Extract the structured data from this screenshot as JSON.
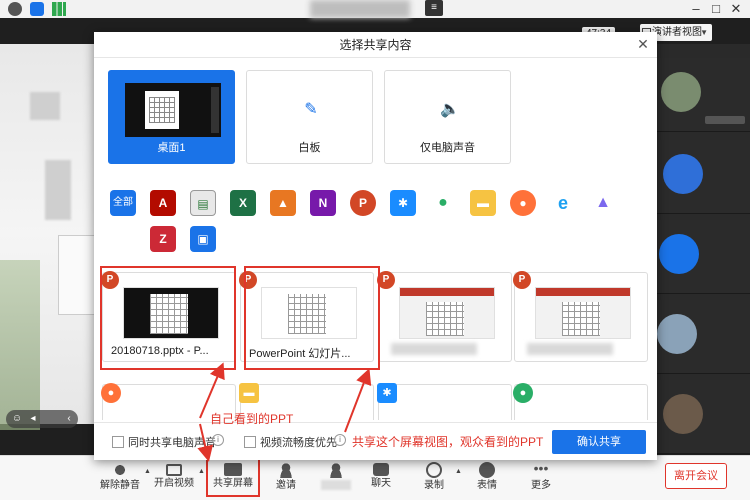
{
  "top_bar": {
    "time": "47:34",
    "view_label": "演讲者视图",
    "window_controls": [
      "minimize-icon",
      "maximize-icon",
      "close-icon"
    ]
  },
  "dialog": {
    "title": "选择共享内容",
    "close_icon": "close-icon",
    "main_options": [
      {
        "label": "桌面1",
        "selected": true
      },
      {
        "label": "白板",
        "icon": "pen-icon"
      },
      {
        "label": "仅电脑声音",
        "icon": "speaker-icon"
      }
    ],
    "filter_all": "全部",
    "app_icons": [
      "acrobat-icon",
      "app-window-icon",
      "excel-icon",
      "matlab-icon",
      "onenote-icon",
      "powerpoint-icon",
      "dingtalk-icon",
      "wechat-icon",
      "folder-icon",
      "firefox-icon",
      "ie-icon",
      "triangle-app-icon",
      "zotero-icon",
      "blue-window-icon"
    ],
    "windows": [
      {
        "label": "20180718.pptx - P..."
      },
      {
        "label": "PowerPoint 幻灯片..."
      },
      {
        "label": ""
      },
      {
        "label": ""
      }
    ],
    "footer": {
      "share_audio": "同时共享电脑声音",
      "video_smooth": "视频流畅度优先",
      "confirm": "确认共享"
    }
  },
  "annotations": {
    "own_view": "自己看到的PPT",
    "audience_view": "共享这个屏幕视图，观众看到的PPT"
  },
  "toolbar": {
    "items": [
      {
        "label": "解除静音",
        "icon": "mic-muted-icon"
      },
      {
        "label": "开启视频",
        "icon": "camera-off-icon"
      },
      {
        "label": "共享屏幕",
        "icon": "share-screen-icon"
      },
      {
        "label": "邀请",
        "icon": "invite-icon"
      },
      {
        "label": "",
        "icon": "participants-icon"
      },
      {
        "label": "聊天",
        "icon": "chat-icon"
      },
      {
        "label": "录制",
        "icon": "record-icon"
      },
      {
        "label": "表情",
        "icon": "emoji-icon"
      },
      {
        "label": "更多",
        "icon": "more-icon"
      }
    ],
    "leave": "离开会议"
  },
  "colors": {
    "accent": "#1a73e8",
    "annotation": "#e0352b"
  }
}
